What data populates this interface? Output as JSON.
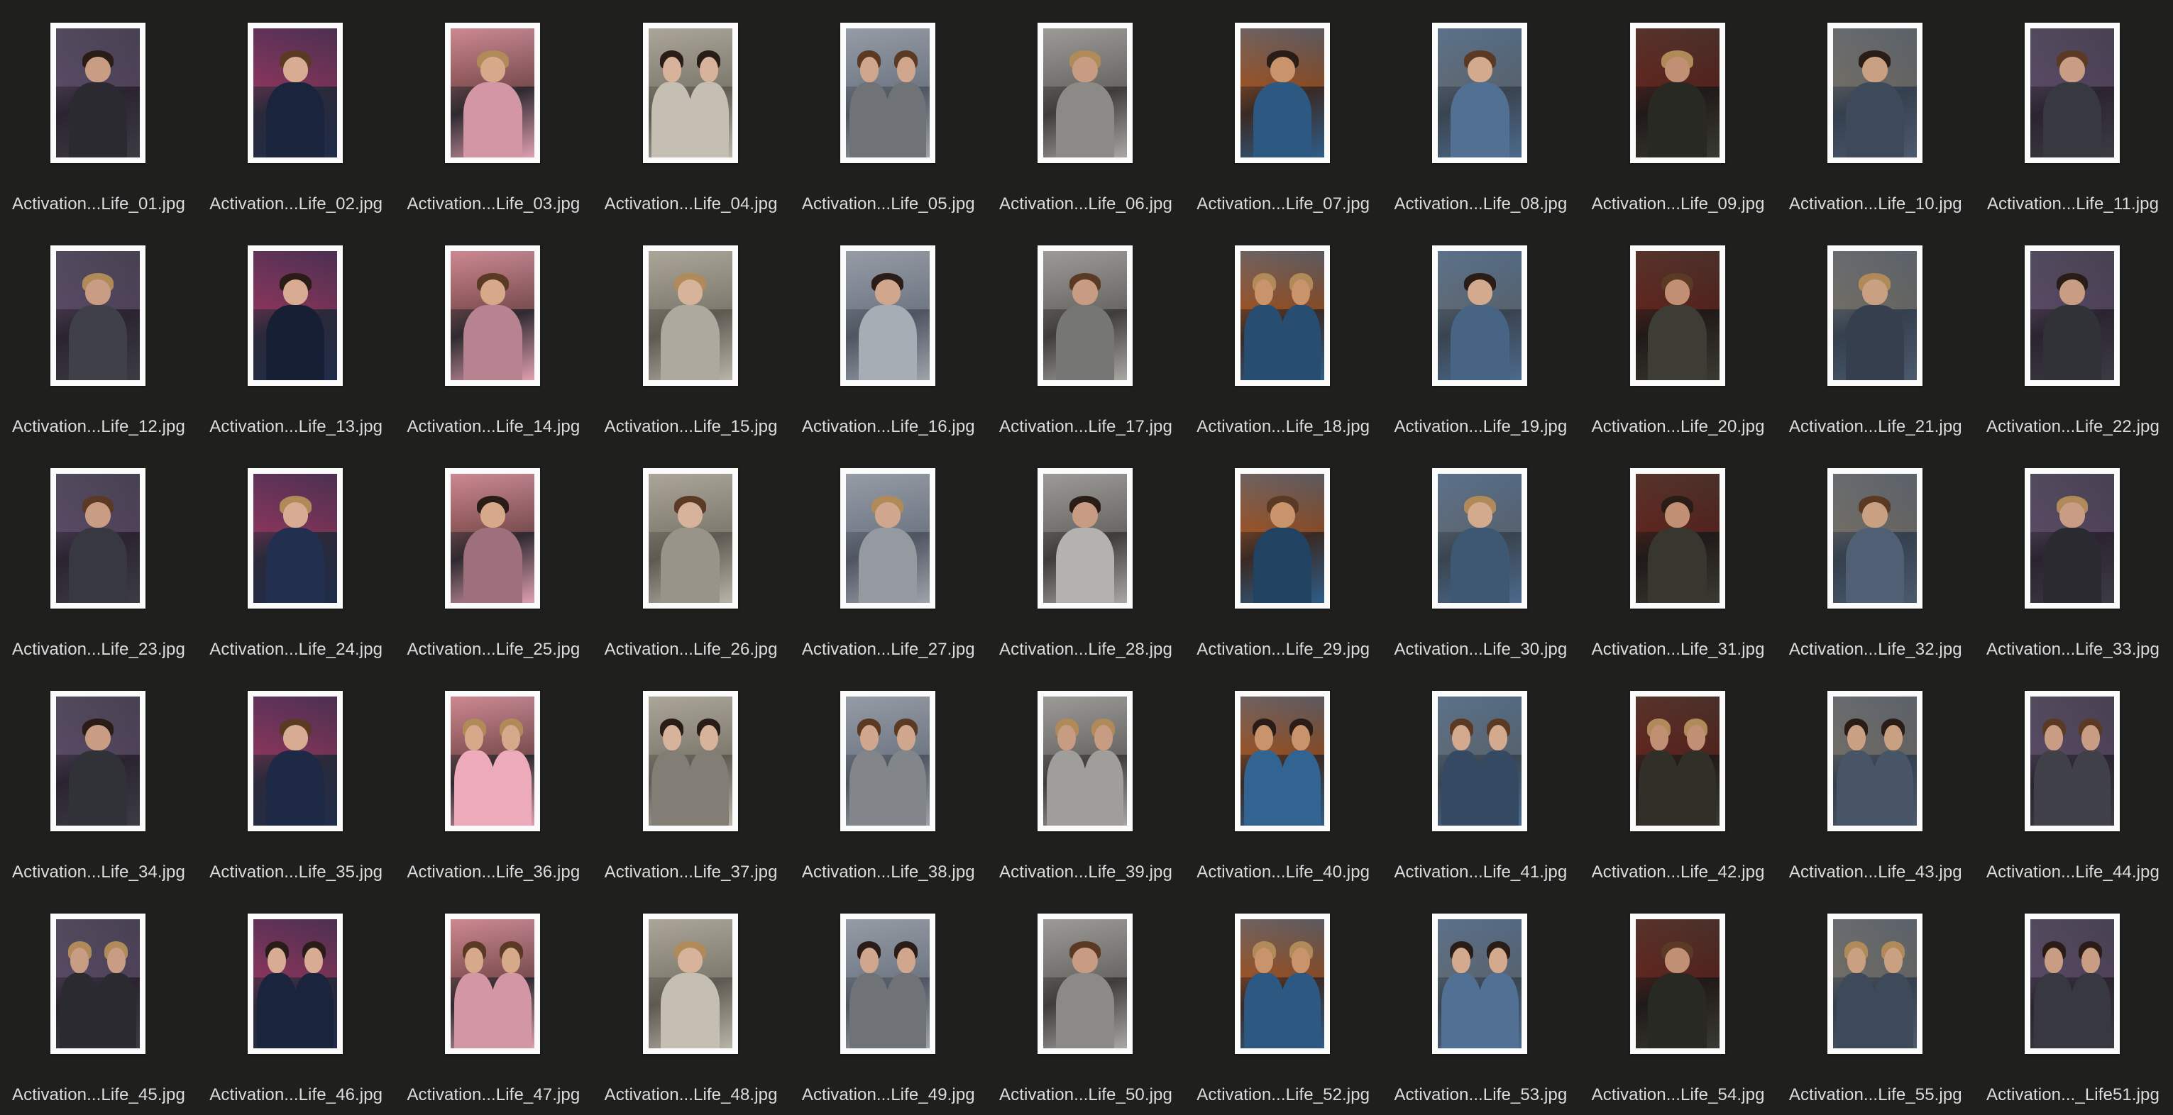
{
  "window": {
    "background": "#1f201e"
  },
  "files": [
    {
      "name": "Activation...Life_01.jpg",
      "icon": "portrait-woman-thumbnail"
    },
    {
      "name": "Activation...Life_02.jpg",
      "icon": "portrait-woman-coat-thumbnail"
    },
    {
      "name": "Activation...Life_03.jpg",
      "icon": "portrait-man-food-thumbnail"
    },
    {
      "name": "Activation...Life_04.jpg",
      "icon": "portrait-couple-thumbnail"
    },
    {
      "name": "Activation...Life_05.jpg",
      "icon": "portrait-couple-thumbnail"
    },
    {
      "name": "Activation...Life_06.jpg",
      "icon": "portrait-man-thumbnail"
    },
    {
      "name": "Activation...Life_07.jpg",
      "icon": "portrait-man-cinema-thumbnail"
    },
    {
      "name": "Activation...Life_08.jpg",
      "icon": "portrait-woman-suit-thumbnail"
    },
    {
      "name": "Activation...Life_09.jpg",
      "icon": "portrait-woman-city-thumbnail"
    },
    {
      "name": "Activation...Life_10.jpg",
      "icon": "portrait-woman-coffee-thumbnail"
    },
    {
      "name": "Activation...Life_11.jpg",
      "icon": "portrait-woman-coffee-thumbnail"
    },
    {
      "name": "Activation...Life_12.jpg",
      "icon": "portrait-woman-selfie-thumbnail"
    },
    {
      "name": "Activation...Life_13.jpg",
      "icon": "portrait-man-selfie-thumbnail"
    },
    {
      "name": "Activation...Life_14.jpg",
      "icon": "portrait-woman-flowers-thumbnail"
    },
    {
      "name": "Activation...Life_15.jpg",
      "icon": "portrait-man-thumbnail"
    },
    {
      "name": "Activation...Life_16.jpg",
      "icon": "portrait-man-phone-thumbnail"
    },
    {
      "name": "Activation...Life_17.jpg",
      "icon": "portrait-man-neon-thumbnail"
    },
    {
      "name": "Activation...Life_18.jpg",
      "icon": "portrait-couple-thumbnail"
    },
    {
      "name": "Activation...Life_19.jpg",
      "icon": "portrait-woman-coat-thumbnail"
    },
    {
      "name": "Activation...Life_20.jpg",
      "icon": "portrait-woman-bench-thumbnail"
    },
    {
      "name": "Activation...Life_21.jpg",
      "icon": "portrait-man-river-thumbnail"
    },
    {
      "name": "Activation...Life_22.jpg",
      "icon": "portrait-man-suit-thumbnail"
    },
    {
      "name": "Activation...Life_23.jpg",
      "icon": "portrait-child-skyline-thumbnail"
    },
    {
      "name": "Activation...Life_24.jpg",
      "icon": "portrait-child-bridge-thumbnail"
    },
    {
      "name": "Activation...Life_25.jpg",
      "icon": "portrait-child-thumbnail"
    },
    {
      "name": "Activation...Life_26.jpg",
      "icon": "portrait-child-thumbnail"
    },
    {
      "name": "Activation...Life_27.jpg",
      "icon": "portrait-girl-thumbnail"
    },
    {
      "name": "Activation...Life_28.jpg",
      "icon": "portrait-girl-thumbnail"
    },
    {
      "name": "Activation...Life_29.jpg",
      "icon": "portrait-girl-hat-thumbnail"
    },
    {
      "name": "Activation...Life_30.jpg",
      "icon": "portrait-child-thumbnail"
    },
    {
      "name": "Activation...Life_31.jpg",
      "icon": "portrait-child-thumbnail"
    },
    {
      "name": "Activation...Life_32.jpg",
      "icon": "portrait-boy-basketball-thumbnail"
    },
    {
      "name": "Activation...Life_33.jpg",
      "icon": "portrait-boy-jacket-thumbnail"
    },
    {
      "name": "Activation...Life_34.jpg",
      "icon": "portrait-boy-thumbnail"
    },
    {
      "name": "Activation...Life_35.jpg",
      "icon": "portrait-boy-thumbnail"
    },
    {
      "name": "Activation...Life_36.jpg",
      "icon": "portrait-two-women-thumbnail"
    },
    {
      "name": "Activation...Life_37.jpg",
      "icon": "portrait-two-women-thumbnail"
    },
    {
      "name": "Activation...Life_38.jpg",
      "icon": "portrait-two-women-thumbnail"
    },
    {
      "name": "Activation...Life_39.jpg",
      "icon": "portrait-three-men-thumbnail"
    },
    {
      "name": "Activation...Life_40.jpg",
      "icon": "portrait-two-men-thumbnail"
    },
    {
      "name": "Activation...Life_41.jpg",
      "icon": "portrait-two-men-thumbnail"
    },
    {
      "name": "Activation...Life_42.jpg",
      "icon": "portrait-two-men-thumbnail"
    },
    {
      "name": "Activation...Life_43.jpg",
      "icon": "portrait-group-thumbnail"
    },
    {
      "name": "Activation...Life_44.jpg",
      "icon": "portrait-group-thumbnail"
    },
    {
      "name": "Activation...Life_45.jpg",
      "icon": "portrait-family-thumbnail"
    },
    {
      "name": "Activation...Life_46.jpg",
      "icon": "portrait-family-thumbnail"
    },
    {
      "name": "Activation...Life_47.jpg",
      "icon": "portrait-elderly-couple-thumbnail"
    },
    {
      "name": "Activation...Life_48.jpg",
      "icon": "portrait-woman-smile-thumbnail"
    },
    {
      "name": "Activation...Life_49.jpg",
      "icon": "portrait-mother-child-thumbnail"
    },
    {
      "name": "Activation...Life_50.jpg",
      "icon": "portrait-woman-jacket-thumbnail"
    },
    {
      "name": "Activation...Life_52.jpg",
      "icon": "portrait-couple-thumbnail"
    },
    {
      "name": "Activation...Life_53.jpg",
      "icon": "portrait-couple-thumbnail"
    },
    {
      "name": "Activation...Life_54.jpg",
      "icon": "portrait-man-shirt-thumbnail"
    },
    {
      "name": "Activation...Life_55.jpg",
      "icon": "portrait-couple-autumn-thumbnail"
    },
    {
      "name": "Activation..._Life51.jpg",
      "icon": "portrait-three-women-thumbnail"
    }
  ]
}
